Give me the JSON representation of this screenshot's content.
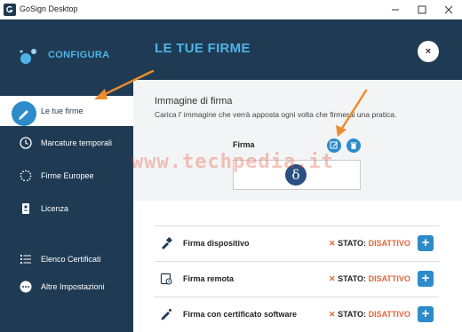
{
  "window": {
    "title": "GoSign Desktop"
  },
  "sidebar": {
    "brand": "CONFIGURA",
    "items": [
      {
        "label": "Le tue firme",
        "icon": "signature-icon",
        "active": true
      },
      {
        "label": "Marcature temporali",
        "icon": "clock-icon"
      },
      {
        "label": "Firme Europee",
        "icon": "eu-stars-icon"
      },
      {
        "label": "Licenza",
        "icon": "license-icon"
      },
      {
        "label": "Elenco Certificati",
        "icon": "list-icon"
      },
      {
        "label": "Altre Impostazioni",
        "icon": "more-icon"
      }
    ]
  },
  "main": {
    "title": "LE TUE FIRME",
    "close_label": "×",
    "section": {
      "title": "Immagine di firma",
      "description": "Carica l' immagine che verrà apposta ogni volta che firmerai una pratica.",
      "firma_label": "Firma"
    },
    "rows": [
      {
        "label": "Firma dispositivo",
        "x": "✕",
        "stato_label": "STATO:",
        "stato_value": "DISATTIVO",
        "plus": "+"
      },
      {
        "label": "Firma remota",
        "x": "✕",
        "stato_label": "STATO:",
        "stato_value": "DISATTIVO",
        "plus": "+"
      },
      {
        "label": "Firma con certificato software",
        "x": "✕",
        "stato_label": "STATO:",
        "stato_value": "DISATTIVO",
        "plus": "+"
      }
    ]
  },
  "watermark": "www.techpedia.it",
  "colors": {
    "sidebar": "#1f3b54",
    "accent": "#2d8bc9",
    "brand": "#4fb3e6",
    "status": "#e0663a"
  }
}
